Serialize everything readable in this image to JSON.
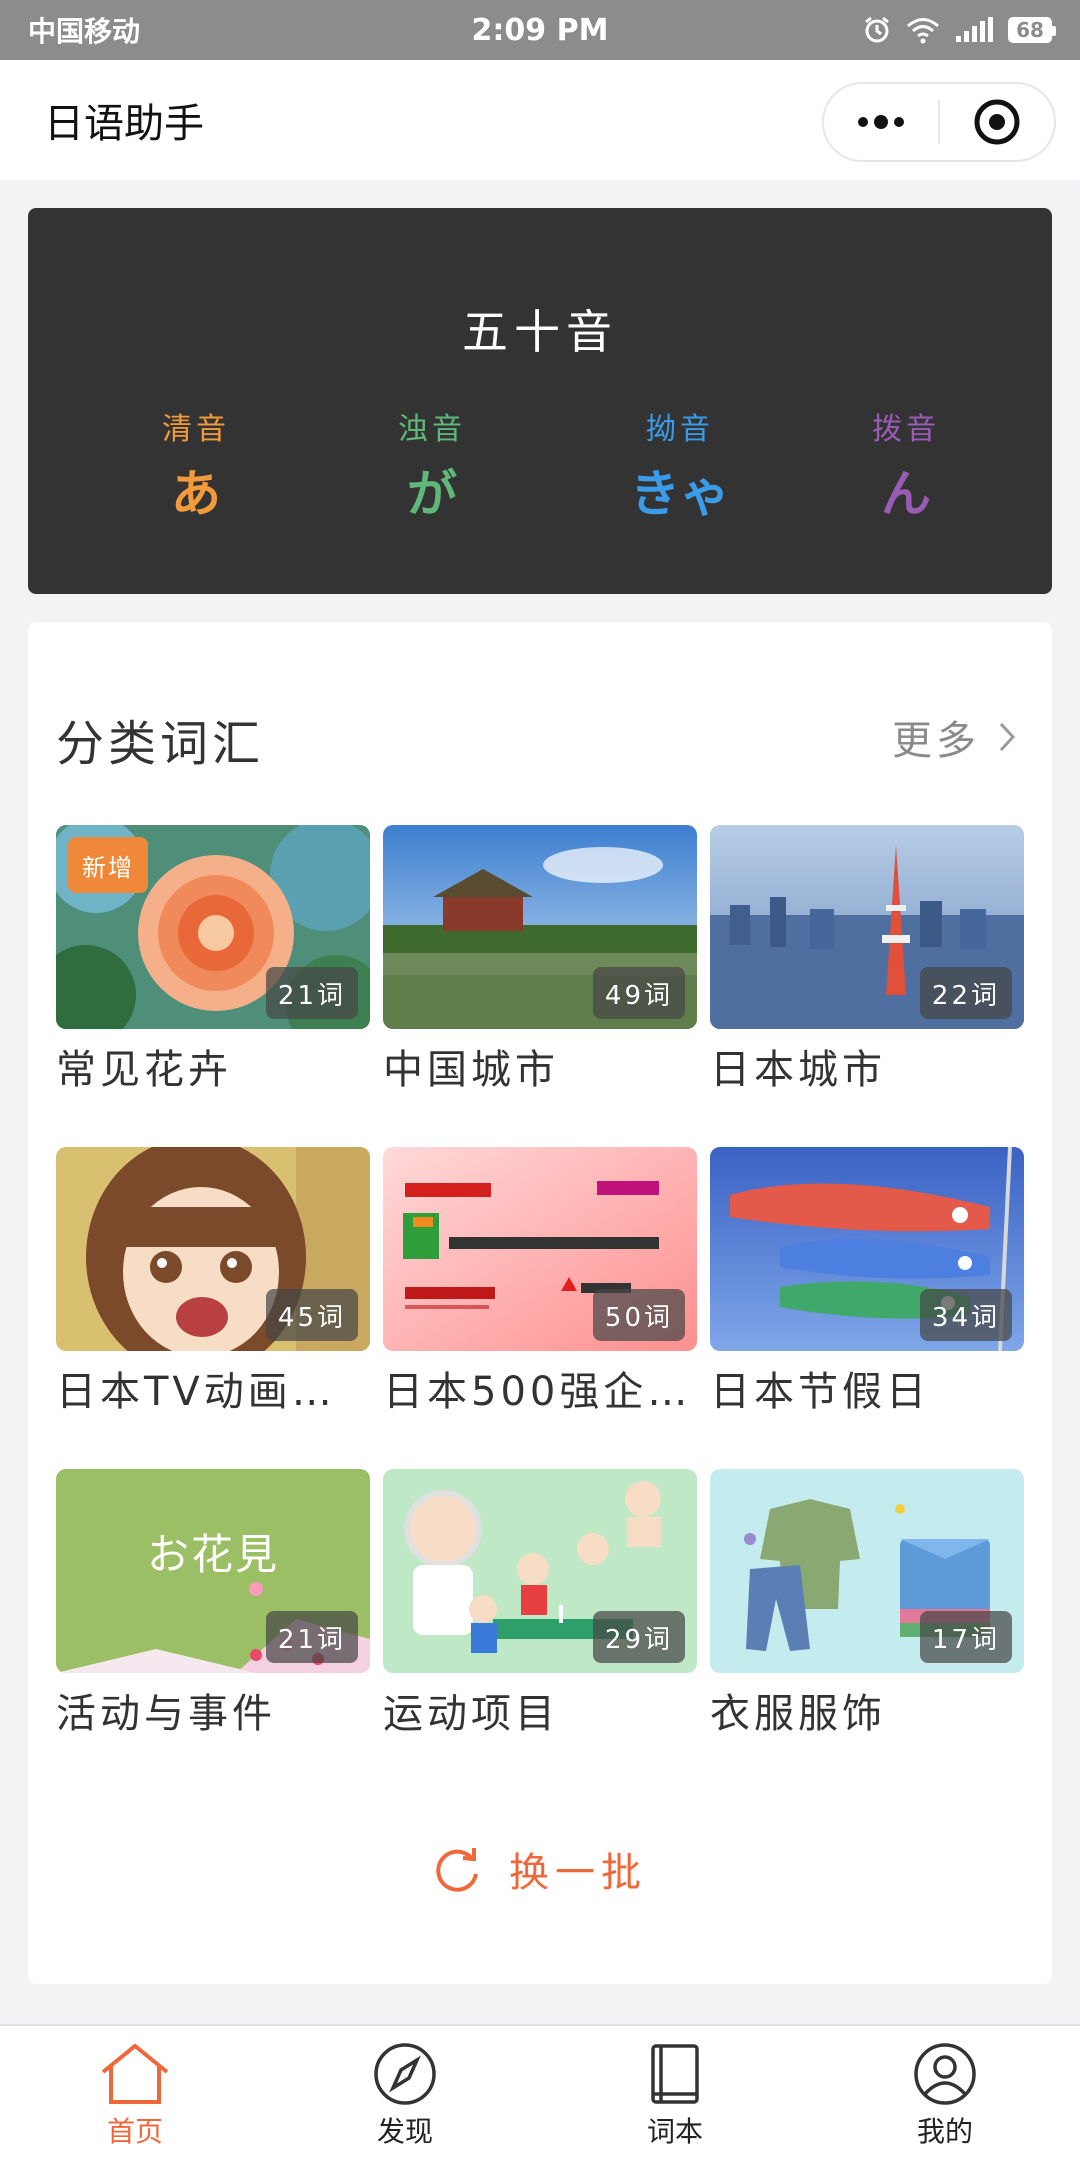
{
  "status_bar": {
    "carrier": "中国移动",
    "time": "2:09 PM",
    "battery": "68"
  },
  "nav": {
    "title": "日语助手",
    "more_icon": "more-dots-icon",
    "close_icon": "target-circle-icon"
  },
  "kana": {
    "title": "五十音",
    "items": [
      {
        "label": "清音",
        "char": "あ",
        "color": "#f39a3b"
      },
      {
        "label": "浊音",
        "char": "が",
        "color": "#5fb878"
      },
      {
        "label": "拗音",
        "char": "きゃ",
        "color": "#3a9be8"
      },
      {
        "label": "拨音",
        "char": "ん",
        "color": "#9a5bb5"
      }
    ]
  },
  "vocab": {
    "section_title": "分类词汇",
    "more_label": "更多",
    "new_badge": "新增",
    "categories": [
      {
        "label": "常见花卉",
        "count": "21词",
        "is_new": true
      },
      {
        "label": "中国城市",
        "count": "49词"
      },
      {
        "label": "日本城市",
        "count": "22词"
      },
      {
        "label": "日本TV动画…",
        "count": "45词"
      },
      {
        "label": "日本500强企…",
        "count": "50词"
      },
      {
        "label": "日本节假日",
        "count": "34词"
      },
      {
        "label": "活动与事件",
        "count": "21词",
        "thumb_text": "お花見"
      },
      {
        "label": "运动项目",
        "count": "29词"
      },
      {
        "label": "衣服服饰",
        "count": "17词"
      }
    ],
    "refresh_label": "换一批"
  },
  "tabs": [
    {
      "label": "首页",
      "icon": "home-icon",
      "active": true
    },
    {
      "label": "发现",
      "icon": "compass-icon"
    },
    {
      "label": "词本",
      "icon": "book-icon"
    },
    {
      "label": "我的",
      "icon": "user-icon"
    }
  ],
  "colors": {
    "accent": "#f0683a",
    "kana_card_bg": "#333333"
  }
}
